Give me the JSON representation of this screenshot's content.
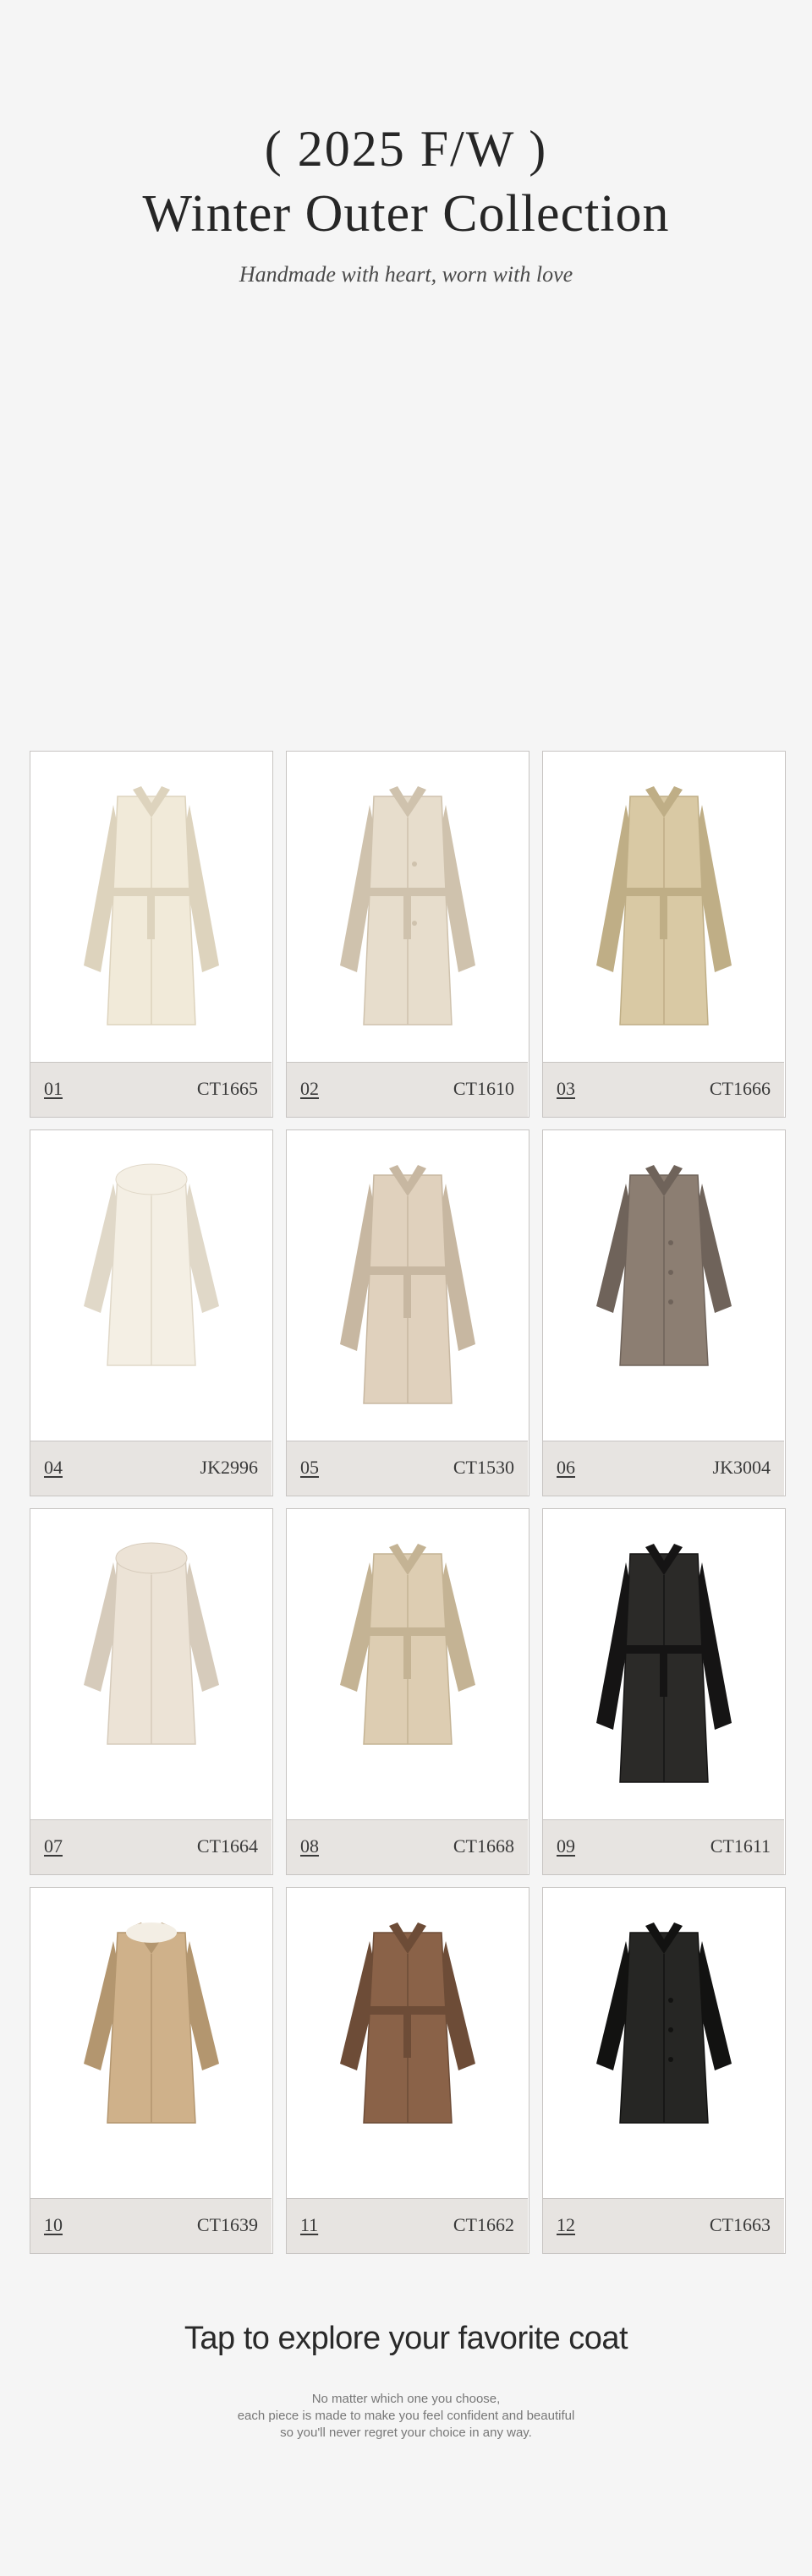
{
  "header": {
    "season": "( 2025 F/W )",
    "title": "Winter Outer Collection",
    "subtitle": "Handmade with heart, worn with love"
  },
  "products": [
    {
      "number": "01",
      "code": "CT1665",
      "icon": "long-belted-coat-icon",
      "color": "#f1ead9",
      "shade": "#ddd3bd"
    },
    {
      "number": "02",
      "code": "CT1610",
      "icon": "double-breasted-belted-coat-icon",
      "color": "#e7ddcc",
      "shade": "#cfc2ad"
    },
    {
      "number": "03",
      "code": "CT1666",
      "icon": "long-belted-coat-icon",
      "color": "#d9c9a4",
      "shade": "#bfae86"
    },
    {
      "number": "04",
      "code": "JK2996",
      "icon": "short-fur-jacket-icon",
      "color": "#f4efe4",
      "shade": "#e0d8c8"
    },
    {
      "number": "05",
      "code": "CT1530",
      "icon": "wrap-coat-icon",
      "color": "#e0d1bd",
      "shade": "#c7b7a1"
    },
    {
      "number": "06",
      "code": "JK3004",
      "icon": "tweed-jacket-icon",
      "color": "#8c7e72",
      "shade": "#6f635a"
    },
    {
      "number": "07",
      "code": "CT1664",
      "icon": "fur-coat-icon",
      "color": "#ece3d6",
      "shade": "#d6cbbb"
    },
    {
      "number": "08",
      "code": "CT1668",
      "icon": "belted-jacket-icon",
      "color": "#ddcdb2",
      "shade": "#c4b394"
    },
    {
      "number": "09",
      "code": "CT1611",
      "icon": "long-belted-coat-icon",
      "color": "#2b2a28",
      "shade": "#151414"
    },
    {
      "number": "10",
      "code": "CT1639",
      "icon": "shearling-collar-coat-icon",
      "color": "#cfb18a",
      "shade": "#b3966f"
    },
    {
      "number": "11",
      "code": "CT1662",
      "icon": "belted-jacket-icon",
      "color": "#8a6248",
      "shade": "#6d4c37"
    },
    {
      "number": "12",
      "code": "CT1663",
      "icon": "short-jacket-icon",
      "color": "#262624",
      "shade": "#121211"
    }
  ],
  "cta": {
    "headline": "Tap to explore your favorite coat",
    "lines": [
      "No matter which one you choose,",
      "each piece is made to make you feel confident and beautiful",
      "so you'll never regret your choice in any way."
    ]
  }
}
